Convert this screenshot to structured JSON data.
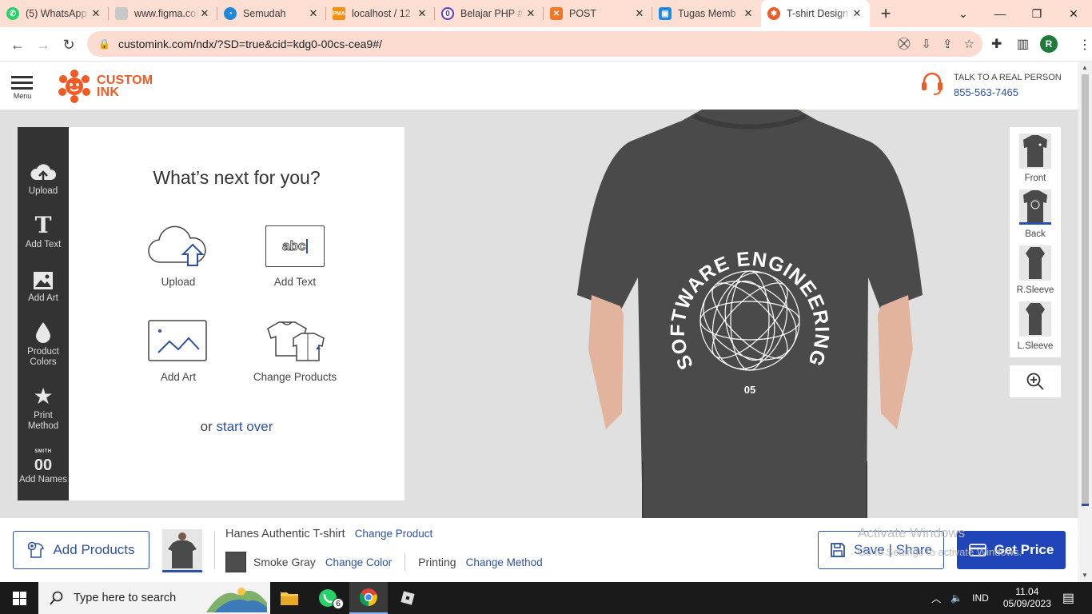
{
  "browser": {
    "tabs": [
      {
        "title": "(5) WhatsApp",
        "icon": "whatsapp-icon",
        "color": "#25d366"
      },
      {
        "title": "www.figma.com",
        "icon": "figma-icon",
        "color": "#a259ff"
      },
      {
        "title": "Semudah",
        "icon": "edge-icon",
        "color": "#1f88d9"
      },
      {
        "title": "localhost / 12",
        "icon": "phpmyadmin-icon",
        "color": "#f29111"
      },
      {
        "title": "Belajar PHP #",
        "icon": "site-icon",
        "color": "#5b39c6"
      },
      {
        "title": "POST",
        "icon": "xampp-icon",
        "color": "#f37624"
      },
      {
        "title": "Tugas Memb",
        "icon": "classroom-icon",
        "color": "#1e88e5"
      },
      {
        "title": "T-shirt Design",
        "icon": "custom-ink-icon",
        "color": "#f15a24"
      }
    ],
    "url": "customink.com/ndx/?SD=true&cid=kdg0-00cs-cea9#/",
    "profile_initial": "R"
  },
  "header": {
    "menu_label": "Menu",
    "logo_line1": "CUSTOM",
    "logo_line2": "INK",
    "talk_label": "TALK TO A REAL PERSON",
    "phone": "855-563-7465"
  },
  "tools": [
    {
      "label": "Upload",
      "icon": "upload-cloud-icon"
    },
    {
      "label": "Add Text",
      "icon": "text-t-icon"
    },
    {
      "label": "Add Art",
      "icon": "image-icon"
    },
    {
      "label": "Product Colors",
      "icon": "color-drop-icon"
    },
    {
      "label": "Print Method",
      "icon": "star-icon"
    },
    {
      "label": "Add Names",
      "icon": "names-numbers-icon",
      "badge": "SMITH",
      "number": "00"
    }
  ],
  "panel": {
    "heading": "What’s next for you?",
    "options": [
      {
        "label": "Upload"
      },
      {
        "label": "Add Text",
        "sample": "abc"
      },
      {
        "label": "Add Art"
      },
      {
        "label": "Change Products"
      }
    ],
    "or_text": "or",
    "start_over": "start over"
  },
  "design": {
    "arc_text": "SOFTWARE ENGINEERING",
    "number": "05",
    "shirt_color": "#4a4a4a"
  },
  "views": [
    {
      "label": "Front"
    },
    {
      "label": "Back",
      "selected": true
    },
    {
      "label": "R.Sleeve"
    },
    {
      "label": "L.Sleeve"
    }
  ],
  "bottom": {
    "add_products": "Add Products",
    "product_name": "Hanes Authentic T-shirt",
    "change_product": "Change Product",
    "color_name": "Smoke Gray",
    "change_color": "Change Color",
    "method": "Printing",
    "change_method": "Change Method",
    "save_share": "Save | Share",
    "get_price": "Get Price"
  },
  "watermark": {
    "line1": "Activate Windows",
    "line2": "Go to Settings to activate Windows."
  },
  "taskbar": {
    "search_placeholder": "Type here to search",
    "whatsapp_badge": "6",
    "language": "IND",
    "time": "11.04",
    "date": "05/09/2023"
  }
}
